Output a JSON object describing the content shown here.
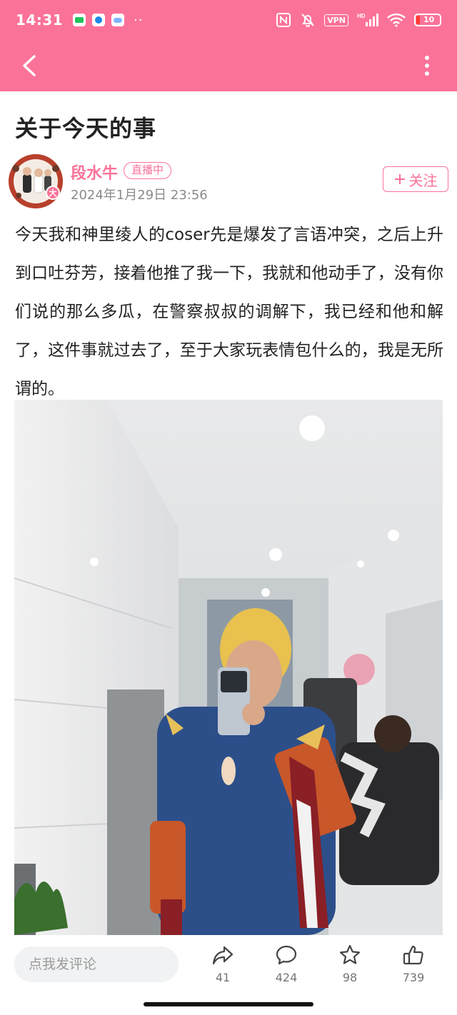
{
  "status_bar": {
    "time": "14:31",
    "app_icons": [
      "green-app-icon",
      "blue-app-icon",
      "cloud-app-icon"
    ],
    "overflow": "··",
    "vpn": "VPN",
    "network": "HD",
    "battery_level": "10",
    "battery_color": "#ff3b30"
  },
  "nav": {
    "back_icon": "chevron-left-icon",
    "more_icon": "more-vertical-icon",
    "bg_color": "#fb7299"
  },
  "post": {
    "title": "关于今天的事",
    "author": {
      "name": "段水牛",
      "live_badge": "直播中",
      "avatar_badge": "大",
      "time": "2024年1月29日 23:56",
      "follow_label": "关注",
      "follow_icon": "plus-icon"
    },
    "body": "今天我和神里绫人的coser先是爆发了言语冲突，之后上升到口吐芬芳，接着他推了我一下，我就和他动手了，没有你们说的那么多瓜，在警察叔叔的调解下，我已经和他和解了，这件事就过去了，至于大家玩表情包什么的，我是无所谓的。"
  },
  "bottom_bar": {
    "comment_placeholder": "点我发评论",
    "actions": [
      {
        "icon": "share-icon",
        "count": "41"
      },
      {
        "icon": "comment-icon",
        "count": "424"
      },
      {
        "icon": "star-icon",
        "count": "98"
      },
      {
        "icon": "thumbs-up-icon",
        "count": "739"
      }
    ]
  },
  "theme": {
    "accent": "#fb7299",
    "text": "#222222",
    "muted": "#8a8a8a"
  }
}
